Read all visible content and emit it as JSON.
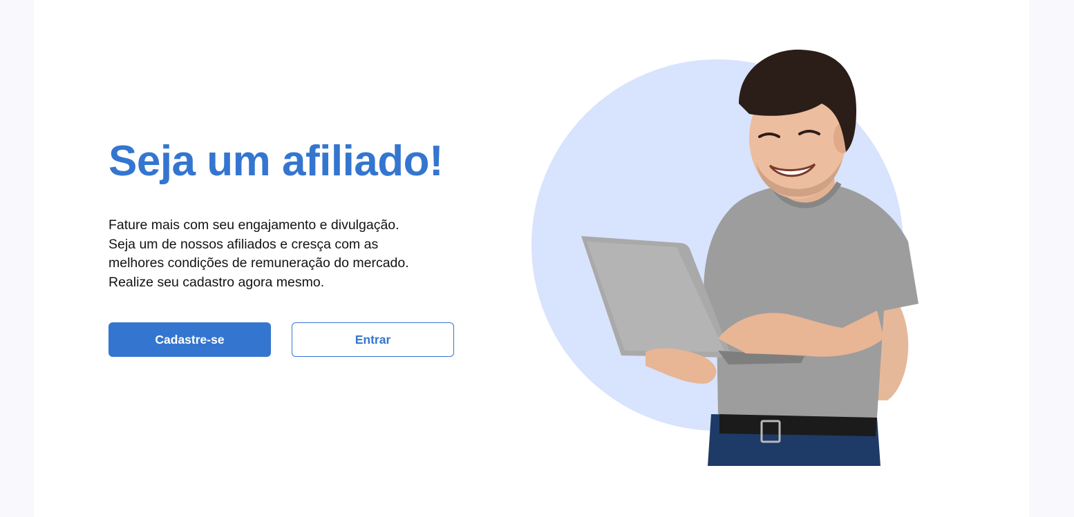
{
  "hero": {
    "title": "Seja um afiliado!",
    "description_lines": [
      "Fature mais com seu engajamento e divulgação.",
      "Seja um de nossos afiliados e cresça com as",
      "melhores condições de remuneração do mercado.",
      "Realize seu cadastro agora mesmo."
    ]
  },
  "actions": {
    "signup_label": "Cadastre-se",
    "login_label": "Entrar"
  },
  "colors": {
    "accent": "#3476cf",
    "circle": "#d8e3fd",
    "page_bg": "#f8f8fd"
  },
  "illustration": {
    "icon": "person-with-laptop-illustration"
  }
}
